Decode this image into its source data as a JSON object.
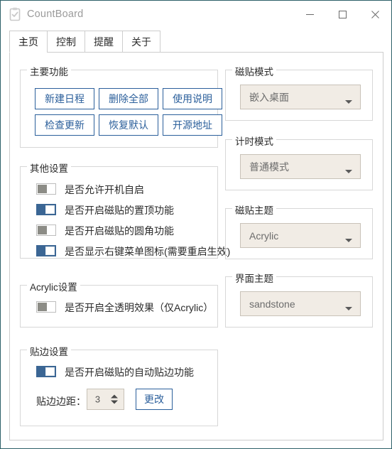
{
  "window": {
    "title": "CountBoard",
    "icon": "clipboard-check-icon",
    "border_color": "#2d6069",
    "controls": {
      "minimize": "minimize-icon",
      "maximize": "maximize-icon",
      "close": "close-icon"
    }
  },
  "tabs": [
    {
      "label": "主页",
      "active": true
    },
    {
      "label": "控制",
      "active": false
    },
    {
      "label": "提醒",
      "active": false
    },
    {
      "label": "关于",
      "active": false
    }
  ],
  "groups": {
    "main_functions": {
      "legend": "主要功能",
      "buttons": [
        "新建日程",
        "删除全部",
        "使用说明",
        "检查更新",
        "恢复默认",
        "开源地址"
      ]
    },
    "other_settings": {
      "legend": "其他设置",
      "switches": [
        {
          "label": "是否允许开机自启",
          "state": "off"
        },
        {
          "label": "是否开启磁贴的置顶功能",
          "state": "on"
        },
        {
          "label": "是否开启磁贴的圆角功能",
          "state": "off"
        },
        {
          "label": "是否显示右键菜单图标(需要重启生效)",
          "state": "on"
        }
      ]
    },
    "acrylic_settings": {
      "legend": "Acrylic设置",
      "switches": [
        {
          "label": "是否开启全透明效果（仅Acrylic）",
          "state": "off"
        }
      ]
    },
    "edge_settings": {
      "legend": "贴边设置",
      "switches": [
        {
          "label": "是否开启磁贴的自动贴边功能",
          "state": "on"
        }
      ],
      "margin_label": "贴边边距：",
      "margin_value": "3",
      "apply_button": "更改"
    },
    "tile_mode": {
      "legend": "磁贴模式",
      "selected": "嵌入桌面"
    },
    "timer_mode": {
      "legend": "计时模式",
      "selected": "普通模式"
    },
    "tile_theme": {
      "legend": "磁贴主题",
      "selected": "Acrylic"
    },
    "ui_theme": {
      "legend": "界面主题",
      "selected": "sandstone"
    }
  },
  "colors": {
    "accent_button": "#2b5f9b",
    "switch_on": "#3b6694",
    "switch_off_knob": "#8c8c86",
    "combo_bg": "#f1ece5",
    "window_border": "#2d6069"
  }
}
